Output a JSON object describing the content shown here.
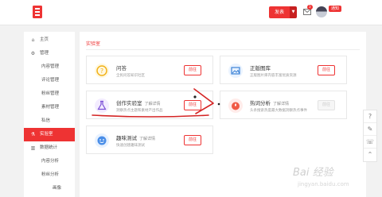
{
  "header": {
    "publish_label": "发表",
    "publish_caret": "▼",
    "message_count": "3",
    "notice_label": "通知"
  },
  "sidebar": {
    "items": [
      {
        "label": "主页",
        "icon": "home-icon",
        "glyph": "⌂"
      },
      {
        "label": "管理",
        "icon": "gear-icon",
        "glyph": "⚙"
      },
      {
        "label": "内容管理"
      },
      {
        "label": "评论管理"
      },
      {
        "label": "粉丝管理"
      },
      {
        "label": "素材管理"
      },
      {
        "label": "私信"
      },
      {
        "label": "实验室",
        "icon": "flask-icon",
        "glyph": "⚗"
      },
      {
        "label": "数据统计",
        "icon": "chart-icon",
        "glyph": "▥"
      },
      {
        "label": "内容分析"
      },
      {
        "label": "粉丝分析"
      },
      {
        "label": "画像"
      }
    ]
  },
  "main": {
    "tab_label": "实验室",
    "cards": [
      {
        "title": "问答",
        "tag": "",
        "desc": "全民问答知识社区",
        "button": "前往",
        "icon": "question-icon"
      },
      {
        "title": "正版图库",
        "tag": "",
        "desc": "正版图片库内容丰富优质资源",
        "button": "前往",
        "icon": "image-icon"
      },
      {
        "title": "创作实验室",
        "tag": "了解详情",
        "desc": "洞察热点主题和素材产出作品",
        "button": "前往",
        "icon": "flask-icon"
      },
      {
        "title": "热词分析",
        "tag": "了解详情",
        "desc": "头条搜索热度最大数据洞察热点事件",
        "button": "前往",
        "icon": "hotword-icon"
      },
      {
        "title": "趣味测试",
        "tag": "了解详情",
        "desc": "快速创建趣味测试",
        "button": "前往",
        "icon": "quiz-icon"
      }
    ]
  },
  "floatbar": {
    "items": [
      {
        "glyph": "?",
        "icon": "help-icon"
      },
      {
        "glyph": "✎",
        "icon": "edit-icon"
      },
      {
        "glyph": "☏",
        "icon": "service-icon"
      },
      {
        "glyph": "⌃",
        "icon": "back-to-top-icon"
      }
    ]
  },
  "watermark": {
    "text": "Bai 经验",
    "sub": "jingyan.baidu.com"
  },
  "colors": {
    "accent": "#e33333",
    "annotation": "#d42424"
  }
}
